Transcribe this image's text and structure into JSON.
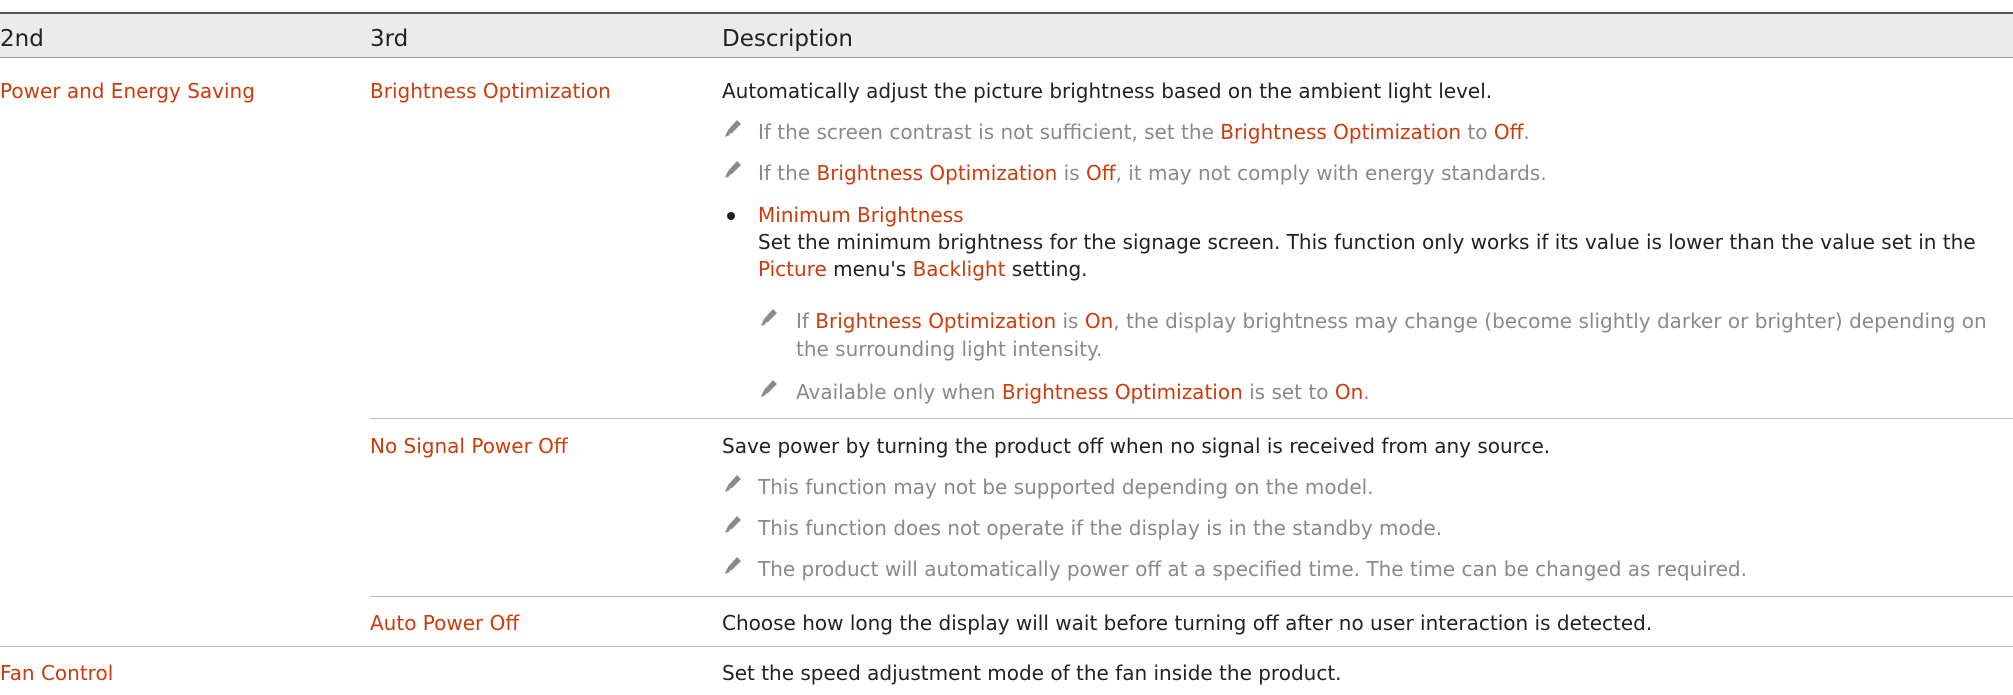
{
  "header": {
    "col1": "2nd",
    "col2": "3rd",
    "col3": "Description"
  },
  "rows": {
    "power": {
      "label": "Power and Energy Saving",
      "brightness": {
        "label": "Brightness Optimization",
        "desc": "Automatically adjust the picture brightness based on the ambient light level.",
        "note1": {
          "a": "If the screen contrast is not sufficient, set the ",
          "b": "Brightness Optimization",
          "c": " to ",
          "d": "Off",
          "e": "."
        },
        "note2": {
          "a": "If the ",
          "b": "Brightness Optimization",
          "c": " is ",
          "d": "Off",
          "e": ", it may not comply with energy standards."
        },
        "min": {
          "title": "Minimum Brightness",
          "line1": "Set the minimum brightness for the signage screen. This function only works if its value is lower than the value set in the",
          "l2a": "Picture",
          "l2b": " menu's ",
          "l2c": "Backlight",
          "l2d": " setting.",
          "note1": {
            "a": "If ",
            "b": "Brightness Optimization",
            "c": " is ",
            "d": "On",
            "e": ", the display brightness may change (become slightly darker or brighter) depending on",
            "f": "the surrounding light intensity."
          },
          "note2": {
            "a": "Available only when ",
            "b": "Brightness Optimization",
            "c": " is set to ",
            "d": "On",
            "e": "."
          }
        }
      },
      "nosignal": {
        "label": "No Signal Power Off",
        "desc": "Save power by turning the product off when no signal is received from any source.",
        "note1": "This function may not be supported depending on the model.",
        "note2": "This function does not operate if the display is in the standby mode.",
        "note3": "The product will automatically power off at a specified time. The time can be changed as required."
      },
      "autooff": {
        "label": "Auto Power Off",
        "desc": "Choose how long the display will wait before turning off after no user interaction is detected."
      }
    },
    "fan": {
      "label": "Fan Control",
      "desc": "Set the speed adjustment mode of the fan inside the product."
    }
  },
  "colors": {
    "accent": "#cc3c0c",
    "note": "#8a8a8a",
    "header_bg": "#ebebeb"
  },
  "icons": {
    "note": "pencil-note-icon",
    "bullet": "bullet-dot"
  }
}
